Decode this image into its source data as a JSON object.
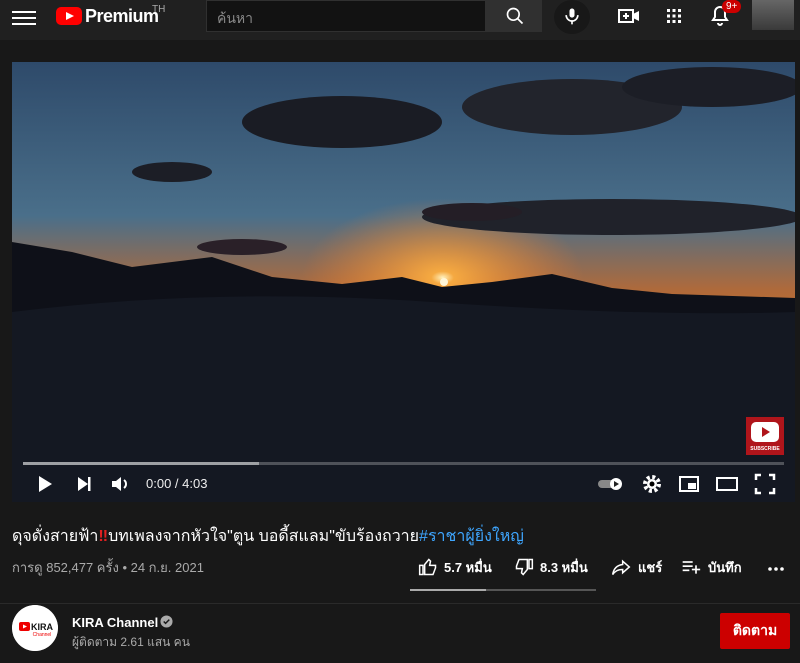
{
  "header": {
    "logo_text": "Premium",
    "country_code": "TH",
    "search_placeholder": "ค้นหา",
    "notification_count": "9+"
  },
  "player": {
    "time_display": "0:00 / 4:03",
    "watermark_label": "SUBSCRIBE",
    "loaded_fraction": 0.31
  },
  "video": {
    "title_part1": "ดุจดั่งสายฟ้า",
    "title_emoji": "‼",
    "title_part2": "บทเพลงจากหัวใจ\"ตูน บอดี้สแลม\"ขับร้องถวาย",
    "title_hashtag": "#ราชาผู้ยิ่งใหญ่",
    "views_date": "การดู 852,477 ครั้ง • 24 ก.ย. 2021"
  },
  "actions": {
    "like_count": "5.7 หมื่น",
    "dislike_count": "8.3 หมื่น",
    "share_label": "แชร์",
    "save_label": "บันทึก",
    "like_ratio": 0.41
  },
  "channel": {
    "name": "KIRA Channel",
    "subscribers": "ผู้ติดตาม 2.61 แสน คน",
    "subscribe_label": "ติดตาม",
    "logo_text": "KIRA",
    "logo_subtext": "Channel"
  },
  "colors": {
    "accent_red": "#cc0000",
    "hashtag_blue": "#3ea6ff",
    "background": "#181818"
  }
}
